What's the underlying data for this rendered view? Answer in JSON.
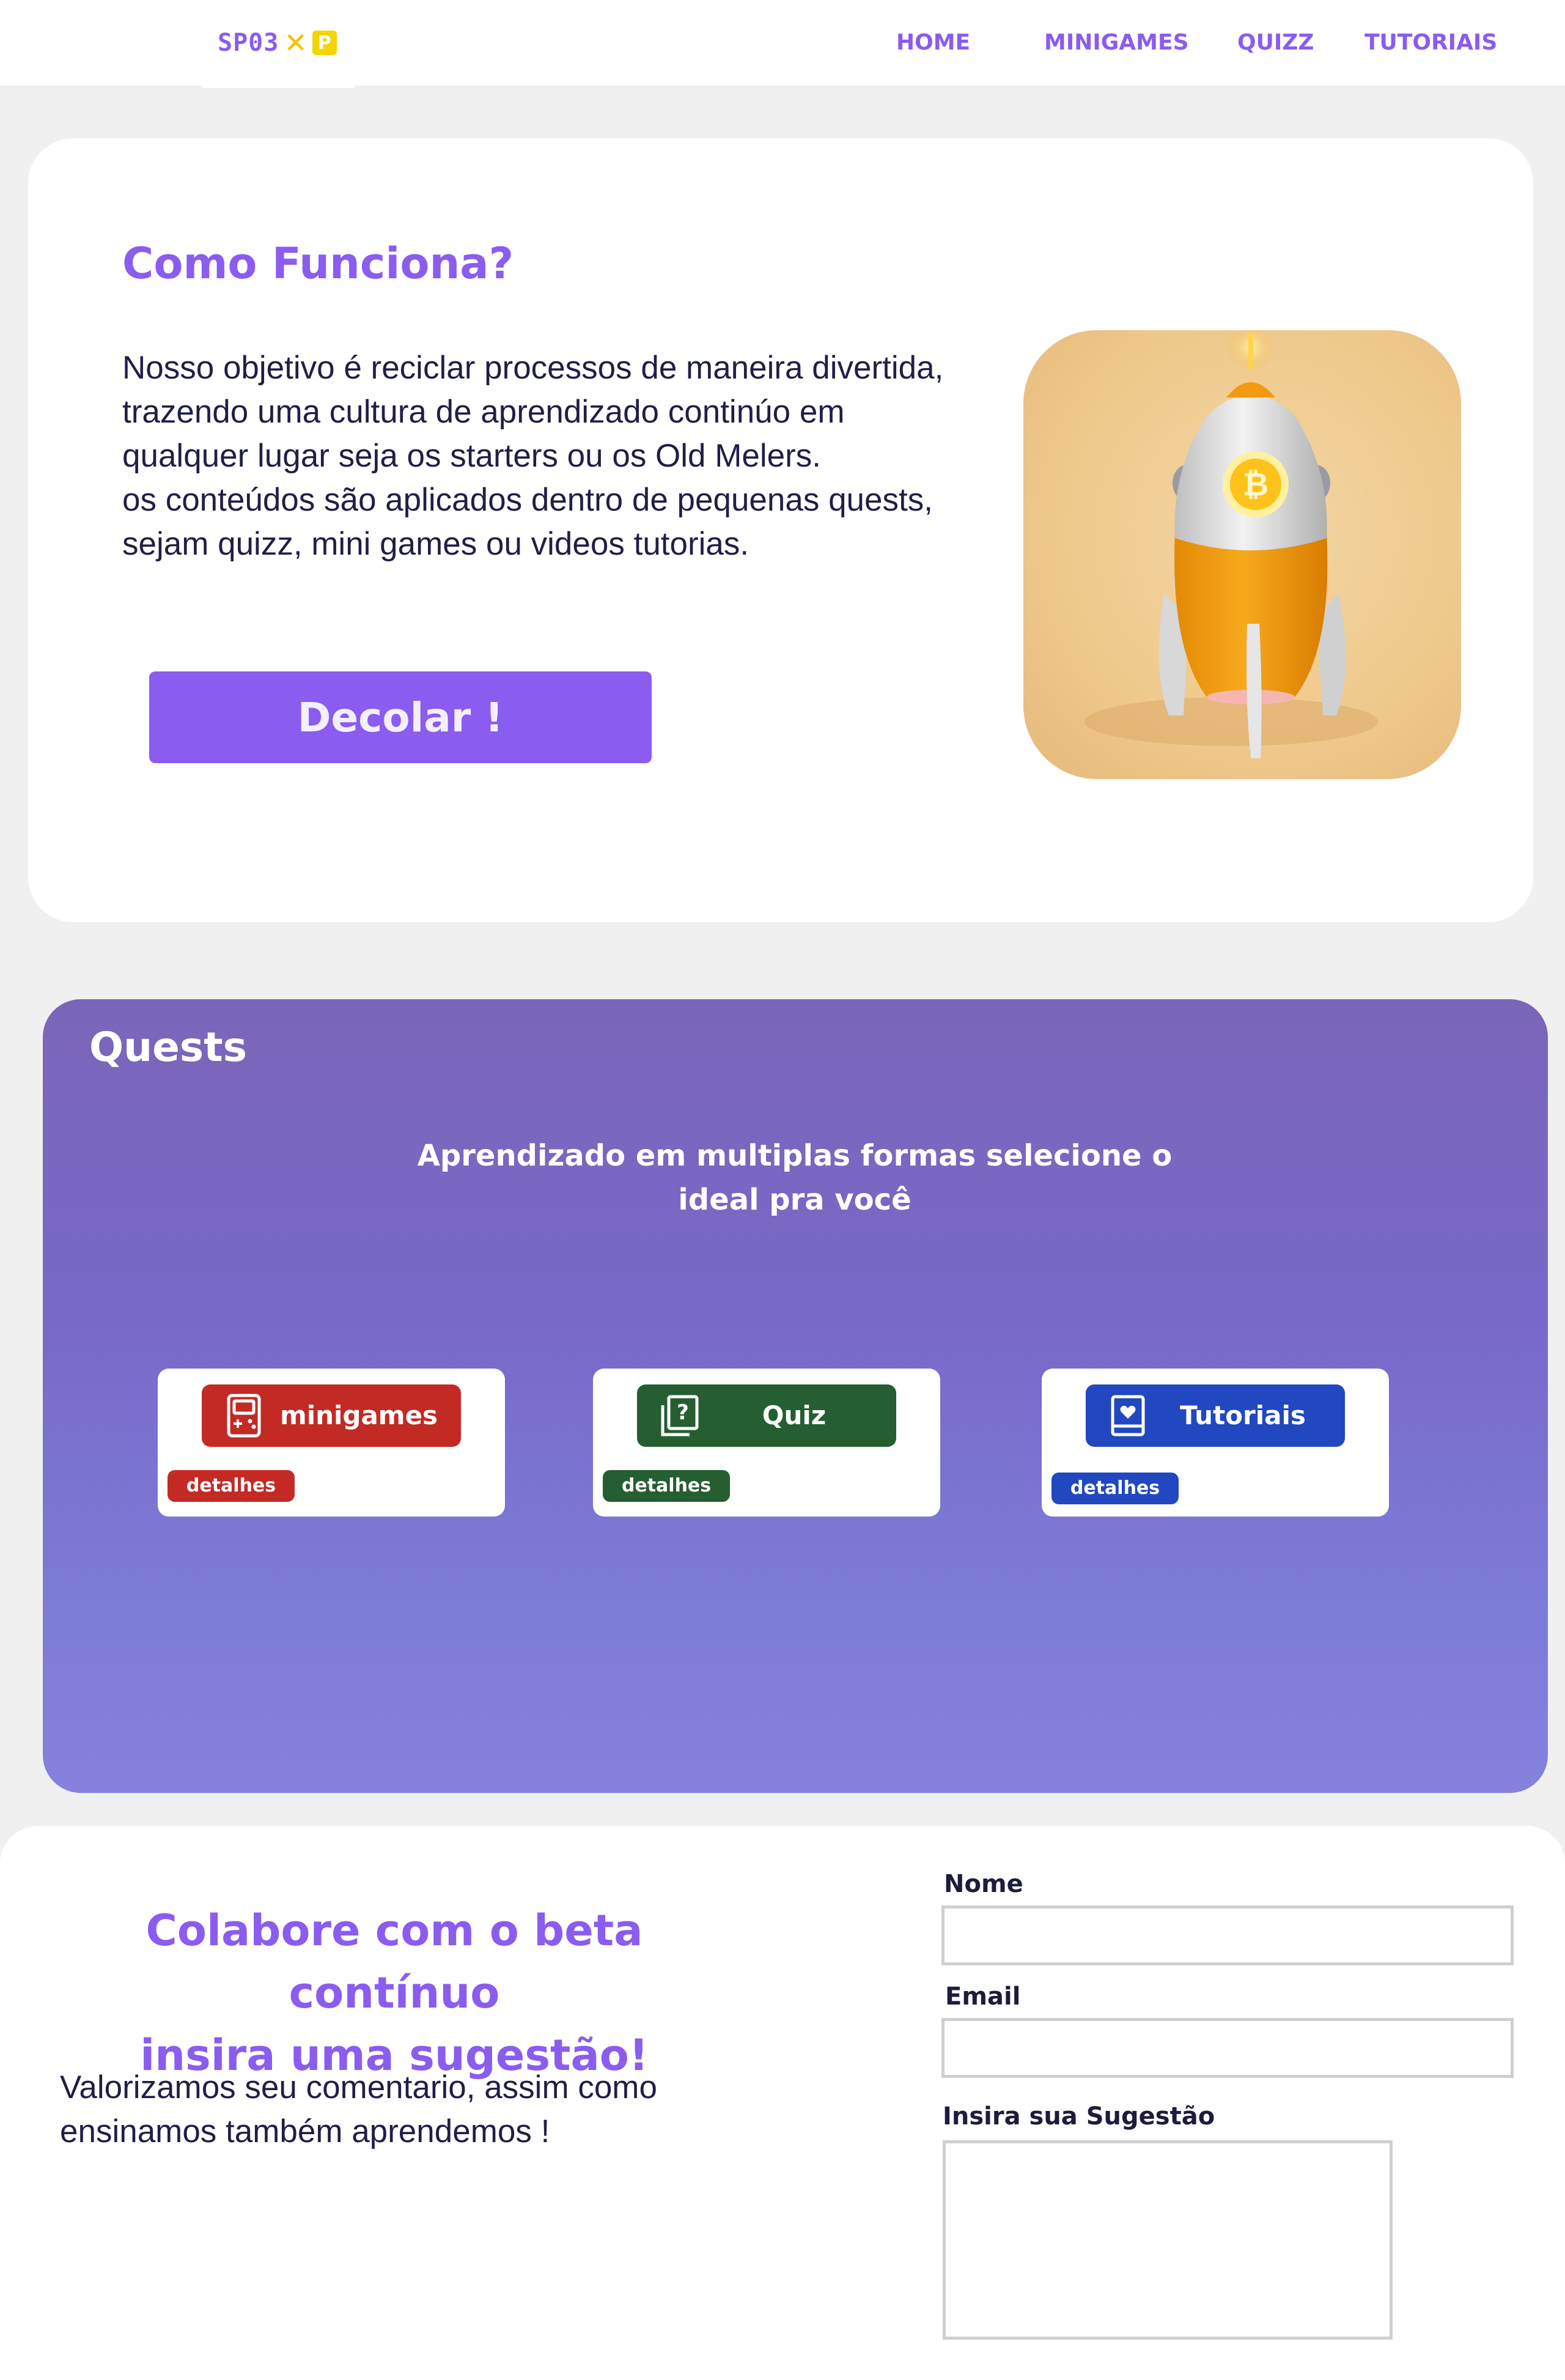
{
  "navbar": {
    "logo_text": "SP03",
    "logo_x": "✕",
    "logo_p": "P",
    "links": [
      "HOME",
      "MINIGAMES",
      "QUIZZ",
      "TUTORIAIS"
    ]
  },
  "hero": {
    "title": "Como Funciona?",
    "paragraph_1": "Nosso objetivo é reciclar processos de maneira divertida, trazendo uma cultura de aprendizado continúo em qualquer lugar seja os starters ou os Old Melers.",
    "paragraph_2": "os conteúdos são aplicados dentro de pequenas quests, sejam quizz, mini games ou videos tutorias.",
    "button_label": "Decolar !",
    "rocket_coin_symbol": "₿"
  },
  "quests": {
    "title": "Quests",
    "subtitle": "Aprendizado em multiplas formas selecione o ideal pra você",
    "cards": [
      {
        "label": "minigames",
        "details": "detalhes",
        "color": "#c32a24",
        "icon": "gamepad-icon"
      },
      {
        "label": "Quiz",
        "details": "detalhes",
        "color": "#255e30",
        "icon": "quiz-icon"
      },
      {
        "label": "Tutoriais",
        "details": "detalhes",
        "color": "#2148c0",
        "icon": "tutorial-book-icon"
      }
    ]
  },
  "suggestion": {
    "title_line_1": "Colabore com o beta contínuo",
    "title_line_2": "insira uma sugestão!",
    "text": "Valorizamos seu comentario, assim como ensinamos também aprendemos !",
    "name_label": "Nome",
    "name_value": "",
    "email_label": "Email",
    "email_value": "",
    "suggestion_label": "Insira sua Sugestão",
    "suggestion_value": ""
  },
  "colors": {
    "accent": "#8a5cf0",
    "page_background": "#f0f0f0",
    "text_dark": "#1f1f46"
  }
}
